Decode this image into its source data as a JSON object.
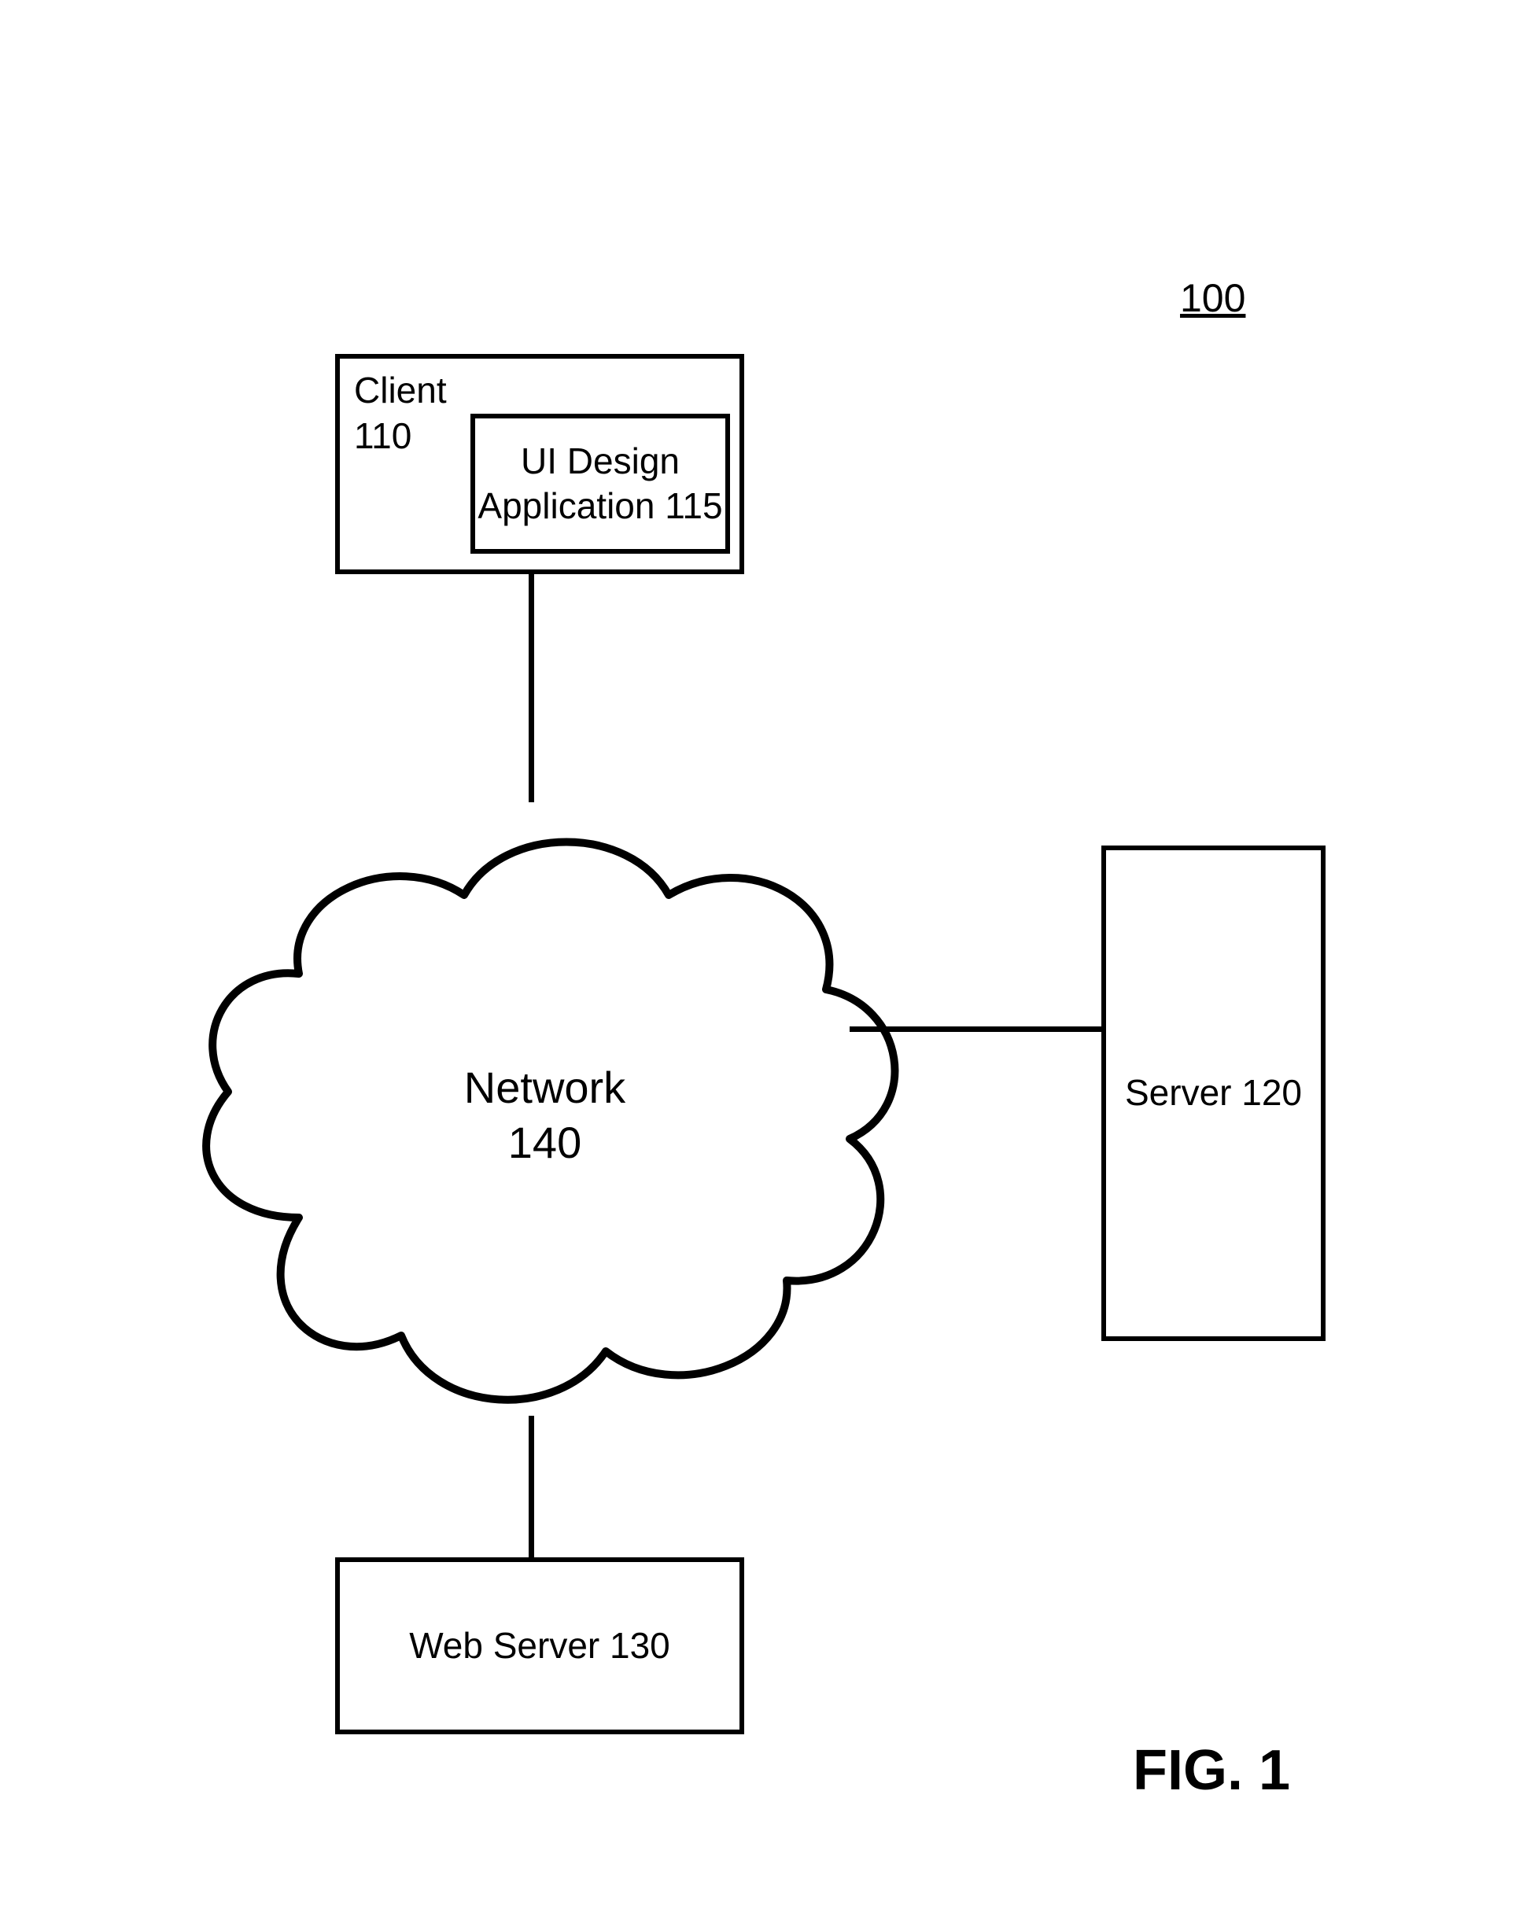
{
  "figure": {
    "reference_number": "100",
    "caption": "FIG. 1"
  },
  "nodes": {
    "client": {
      "title": "Client\n110",
      "inner": "UI Design\nApplication 115"
    },
    "server": "Server 120",
    "web_server": "Web Server 130",
    "network": "Network\n140"
  }
}
